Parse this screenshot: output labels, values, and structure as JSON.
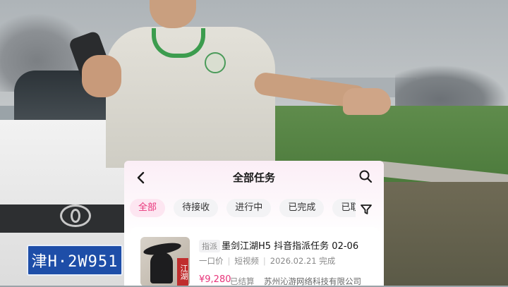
{
  "photo": {
    "license_plate": "津H·2W951"
  },
  "app": {
    "header": {
      "title": "全部任务",
      "back_icon": "chevron-left-icon",
      "search_icon": "search-icon"
    },
    "tabs": [
      {
        "label": "全部",
        "active": true
      },
      {
        "label": "待接收",
        "active": false
      },
      {
        "label": "进行中",
        "active": false
      },
      {
        "label": "已完成",
        "active": false
      },
      {
        "label": "已取",
        "active": false
      }
    ],
    "filter_icon": "filter-icon",
    "task": {
      "tag": "指派",
      "title": "墨剑江湖H5 抖音指派任务 02-06",
      "pricing_type": "一口价",
      "media_type": "短视频",
      "date_status": "2026.02.21 完成",
      "price": "¥9,280",
      "settlement": "已结算",
      "company": "苏州沁游网络科技有限公司",
      "thumb_text": "江湖"
    },
    "colors": {
      "accent": "#e8347a",
      "active_tab_bg": "#fde6f1"
    }
  }
}
